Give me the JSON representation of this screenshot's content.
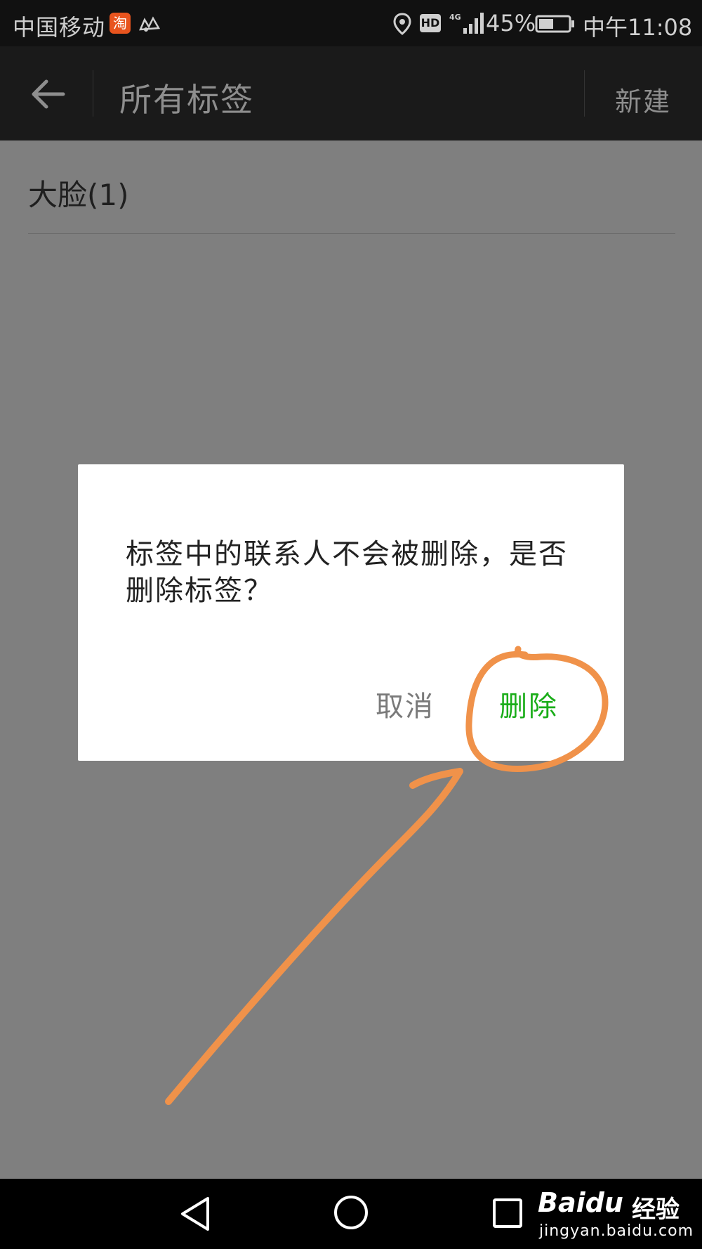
{
  "status_bar": {
    "carrier": "中国移动",
    "taobao_badge": "淘",
    "hd_badge": "HD",
    "network": "4G",
    "battery_percent": "45%",
    "time": "中午11:08"
  },
  "toolbar": {
    "title": "所有标签",
    "new_label": "新建"
  },
  "tags": [
    {
      "label": "大脸(1)"
    }
  ],
  "dialog": {
    "message": "标签中的联系人不会被删除，是否删除标签？",
    "cancel_label": "取消",
    "delete_label": "删除",
    "accent_color": "#1aad19"
  },
  "annotation": {
    "color": "#f0924a",
    "icons": [
      "circle-highlight",
      "arrow"
    ]
  },
  "watermark": {
    "brand": "Baidu",
    "brand_cn": "经验",
    "url": "jingyan.baidu.com"
  }
}
